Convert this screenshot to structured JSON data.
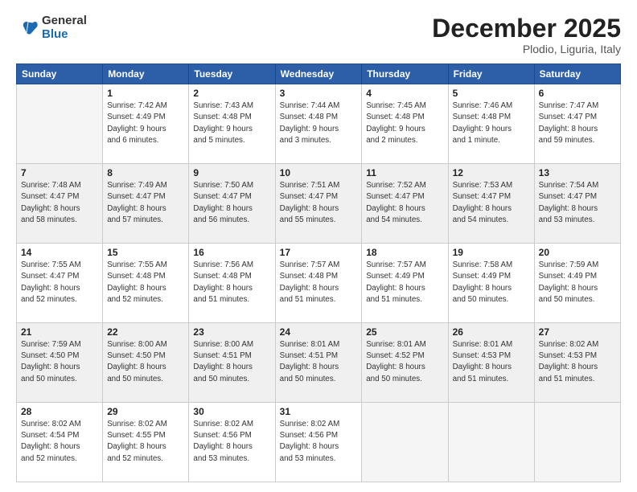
{
  "logo": {
    "general": "General",
    "blue": "Blue"
  },
  "title": "December 2025",
  "location": "Plodio, Liguria, Italy",
  "days_header": [
    "Sunday",
    "Monday",
    "Tuesday",
    "Wednesday",
    "Thursday",
    "Friday",
    "Saturday"
  ],
  "weeks": [
    [
      {
        "day": "",
        "info": ""
      },
      {
        "day": "1",
        "info": "Sunrise: 7:42 AM\nSunset: 4:49 PM\nDaylight: 9 hours\nand 6 minutes."
      },
      {
        "day": "2",
        "info": "Sunrise: 7:43 AM\nSunset: 4:48 PM\nDaylight: 9 hours\nand 5 minutes."
      },
      {
        "day": "3",
        "info": "Sunrise: 7:44 AM\nSunset: 4:48 PM\nDaylight: 9 hours\nand 3 minutes."
      },
      {
        "day": "4",
        "info": "Sunrise: 7:45 AM\nSunset: 4:48 PM\nDaylight: 9 hours\nand 2 minutes."
      },
      {
        "day": "5",
        "info": "Sunrise: 7:46 AM\nSunset: 4:48 PM\nDaylight: 9 hours\nand 1 minute."
      },
      {
        "day": "6",
        "info": "Sunrise: 7:47 AM\nSunset: 4:47 PM\nDaylight: 8 hours\nand 59 minutes."
      }
    ],
    [
      {
        "day": "7",
        "info": "Sunrise: 7:48 AM\nSunset: 4:47 PM\nDaylight: 8 hours\nand 58 minutes."
      },
      {
        "day": "8",
        "info": "Sunrise: 7:49 AM\nSunset: 4:47 PM\nDaylight: 8 hours\nand 57 minutes."
      },
      {
        "day": "9",
        "info": "Sunrise: 7:50 AM\nSunset: 4:47 PM\nDaylight: 8 hours\nand 56 minutes."
      },
      {
        "day": "10",
        "info": "Sunrise: 7:51 AM\nSunset: 4:47 PM\nDaylight: 8 hours\nand 55 minutes."
      },
      {
        "day": "11",
        "info": "Sunrise: 7:52 AM\nSunset: 4:47 PM\nDaylight: 8 hours\nand 54 minutes."
      },
      {
        "day": "12",
        "info": "Sunrise: 7:53 AM\nSunset: 4:47 PM\nDaylight: 8 hours\nand 54 minutes."
      },
      {
        "day": "13",
        "info": "Sunrise: 7:54 AM\nSunset: 4:47 PM\nDaylight: 8 hours\nand 53 minutes."
      }
    ],
    [
      {
        "day": "14",
        "info": "Sunrise: 7:55 AM\nSunset: 4:47 PM\nDaylight: 8 hours\nand 52 minutes."
      },
      {
        "day": "15",
        "info": "Sunrise: 7:55 AM\nSunset: 4:48 PM\nDaylight: 8 hours\nand 52 minutes."
      },
      {
        "day": "16",
        "info": "Sunrise: 7:56 AM\nSunset: 4:48 PM\nDaylight: 8 hours\nand 51 minutes."
      },
      {
        "day": "17",
        "info": "Sunrise: 7:57 AM\nSunset: 4:48 PM\nDaylight: 8 hours\nand 51 minutes."
      },
      {
        "day": "18",
        "info": "Sunrise: 7:57 AM\nSunset: 4:49 PM\nDaylight: 8 hours\nand 51 minutes."
      },
      {
        "day": "19",
        "info": "Sunrise: 7:58 AM\nSunset: 4:49 PM\nDaylight: 8 hours\nand 50 minutes."
      },
      {
        "day": "20",
        "info": "Sunrise: 7:59 AM\nSunset: 4:49 PM\nDaylight: 8 hours\nand 50 minutes."
      }
    ],
    [
      {
        "day": "21",
        "info": "Sunrise: 7:59 AM\nSunset: 4:50 PM\nDaylight: 8 hours\nand 50 minutes."
      },
      {
        "day": "22",
        "info": "Sunrise: 8:00 AM\nSunset: 4:50 PM\nDaylight: 8 hours\nand 50 minutes."
      },
      {
        "day": "23",
        "info": "Sunrise: 8:00 AM\nSunset: 4:51 PM\nDaylight: 8 hours\nand 50 minutes."
      },
      {
        "day": "24",
        "info": "Sunrise: 8:01 AM\nSunset: 4:51 PM\nDaylight: 8 hours\nand 50 minutes."
      },
      {
        "day": "25",
        "info": "Sunrise: 8:01 AM\nSunset: 4:52 PM\nDaylight: 8 hours\nand 50 minutes."
      },
      {
        "day": "26",
        "info": "Sunrise: 8:01 AM\nSunset: 4:53 PM\nDaylight: 8 hours\nand 51 minutes."
      },
      {
        "day": "27",
        "info": "Sunrise: 8:02 AM\nSunset: 4:53 PM\nDaylight: 8 hours\nand 51 minutes."
      }
    ],
    [
      {
        "day": "28",
        "info": "Sunrise: 8:02 AM\nSunset: 4:54 PM\nDaylight: 8 hours\nand 52 minutes."
      },
      {
        "day": "29",
        "info": "Sunrise: 8:02 AM\nSunset: 4:55 PM\nDaylight: 8 hours\nand 52 minutes."
      },
      {
        "day": "30",
        "info": "Sunrise: 8:02 AM\nSunset: 4:56 PM\nDaylight: 8 hours\nand 53 minutes."
      },
      {
        "day": "31",
        "info": "Sunrise: 8:02 AM\nSunset: 4:56 PM\nDaylight: 8 hours\nand 53 minutes."
      },
      {
        "day": "",
        "info": ""
      },
      {
        "day": "",
        "info": ""
      },
      {
        "day": "",
        "info": ""
      }
    ]
  ]
}
